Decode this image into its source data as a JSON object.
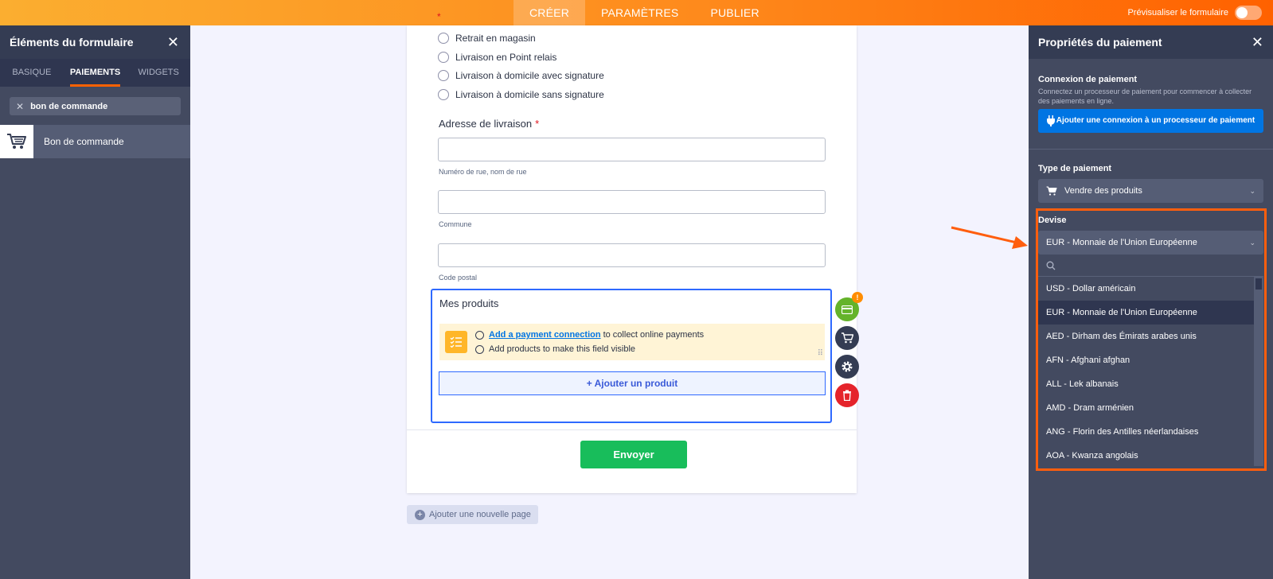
{
  "topbar": {
    "tabs": [
      {
        "label": "CRÉER",
        "active": true
      },
      {
        "label": "PARAMÈTRES",
        "active": false
      },
      {
        "label": "PUBLIER",
        "active": false
      }
    ],
    "preview_label": "Prévisualiser le formulaire",
    "star": "*"
  },
  "left_panel": {
    "title": "Éléments du formulaire",
    "tabs": [
      "BASIQUE",
      "PAIEMENTS",
      "WIDGETS"
    ],
    "active_tab": "PAIEMENTS",
    "search_value": "bon de commande",
    "item_label": "Bon de commande"
  },
  "form": {
    "radio_options": [
      "Retrait en magasin",
      "Livraison en Point relais",
      "Livraison à domicile avec signature",
      "Livraison à domicile sans signature"
    ],
    "address_label": "Adresse de livraison",
    "required_mark": "*",
    "sublabels": [
      "Numéro de rue, nom de rue",
      "Commune",
      "Code postal"
    ],
    "products": {
      "title": "Mes produits",
      "warning_link": "Add a payment connection",
      "warning_line1_rest": "to collect online payments",
      "warning_line2": "Add products to make this field visible",
      "add_button": "+ Ajouter un produit",
      "badge": "!"
    },
    "submit_label": "Envoyer",
    "add_page_label": "Ajouter une nouvelle page"
  },
  "right_panel": {
    "title": "Propriétés du paiement",
    "connection_heading": "Connexion de paiement",
    "connection_desc": "Connectez un processeur de paiement pour commencer à collecter des paiements en ligne.",
    "connect_button": "Ajouter une connexion à un processeur de paiement",
    "payment_type_heading": "Type de paiement",
    "payment_type_value": "Vendre des produits",
    "currency_heading": "Devise",
    "currency_value": "EUR - Monnaie de l'Union Européenne",
    "currency_options": [
      "USD - Dollar américain",
      "EUR - Monnaie de l'Union Européenne",
      "AED - Dirham des Émirats arabes unis",
      "AFN - Afghani afghan",
      "ALL - Lek albanais",
      "AMD - Dram arménien",
      "ANG - Florin des Antilles néerlandaises",
      "AOA - Kwanza angolais"
    ],
    "selected_option_index": 1
  },
  "colors": {
    "accent_orange": "#ff6100",
    "submit_green": "#18bd5b",
    "connect_blue": "#0075e3",
    "delete_red": "#e5242b",
    "warning_yellow": "#ffb629"
  }
}
